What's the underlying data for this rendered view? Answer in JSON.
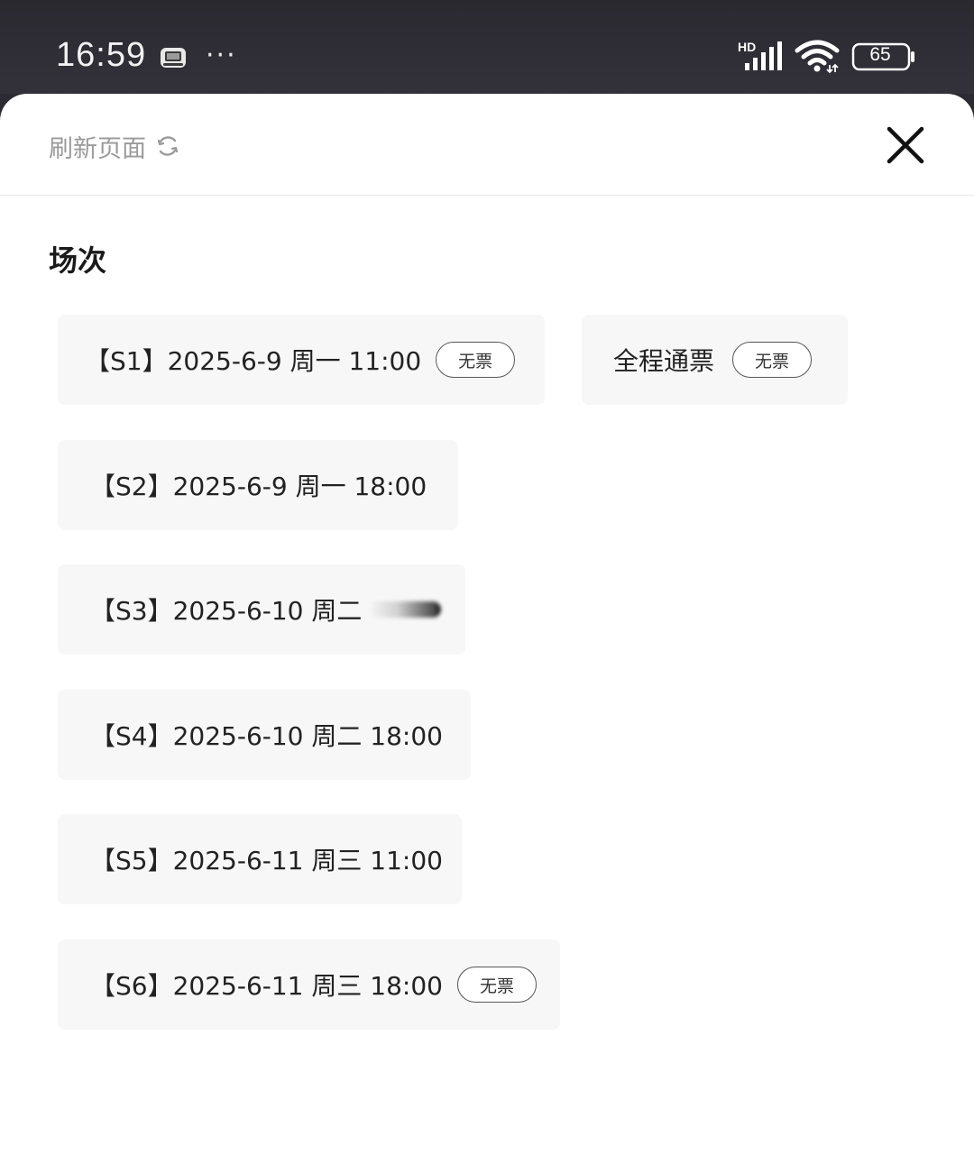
{
  "status_bar": {
    "time": "16:59",
    "dots": "···",
    "network_label": "HD",
    "battery_level": "65",
    "icons": [
      "app-notification-icon",
      "signal-icon",
      "wifi-icon",
      "battery-icon"
    ]
  },
  "header": {
    "refresh_label": "刷新页面",
    "refresh_icon": "refresh-icon",
    "close_icon": "close-icon"
  },
  "section": {
    "title": "场次"
  },
  "sessions": [
    {
      "label": "【S1】2025-6-9 周一 11:00",
      "badge": "无票"
    },
    {
      "label": "全程通票",
      "badge": "无票"
    },
    {
      "label": "【S2】2025-6-9 周一 18:00"
    },
    {
      "label": "【S3】2025-6-10 周二"
    },
    {
      "label": "【S4】2025-6-10 周二 18:00"
    },
    {
      "label": "【S5】2025-6-11 周三 11:00"
    },
    {
      "label": "【S6】2025-6-11 周三 18:00",
      "badge": "无票"
    }
  ],
  "colors": {
    "status_bar_bg": "#2c2b33",
    "card_bg": "#f7f7f7",
    "text_primary": "#222222",
    "text_muted": "#9a9a9a"
  }
}
